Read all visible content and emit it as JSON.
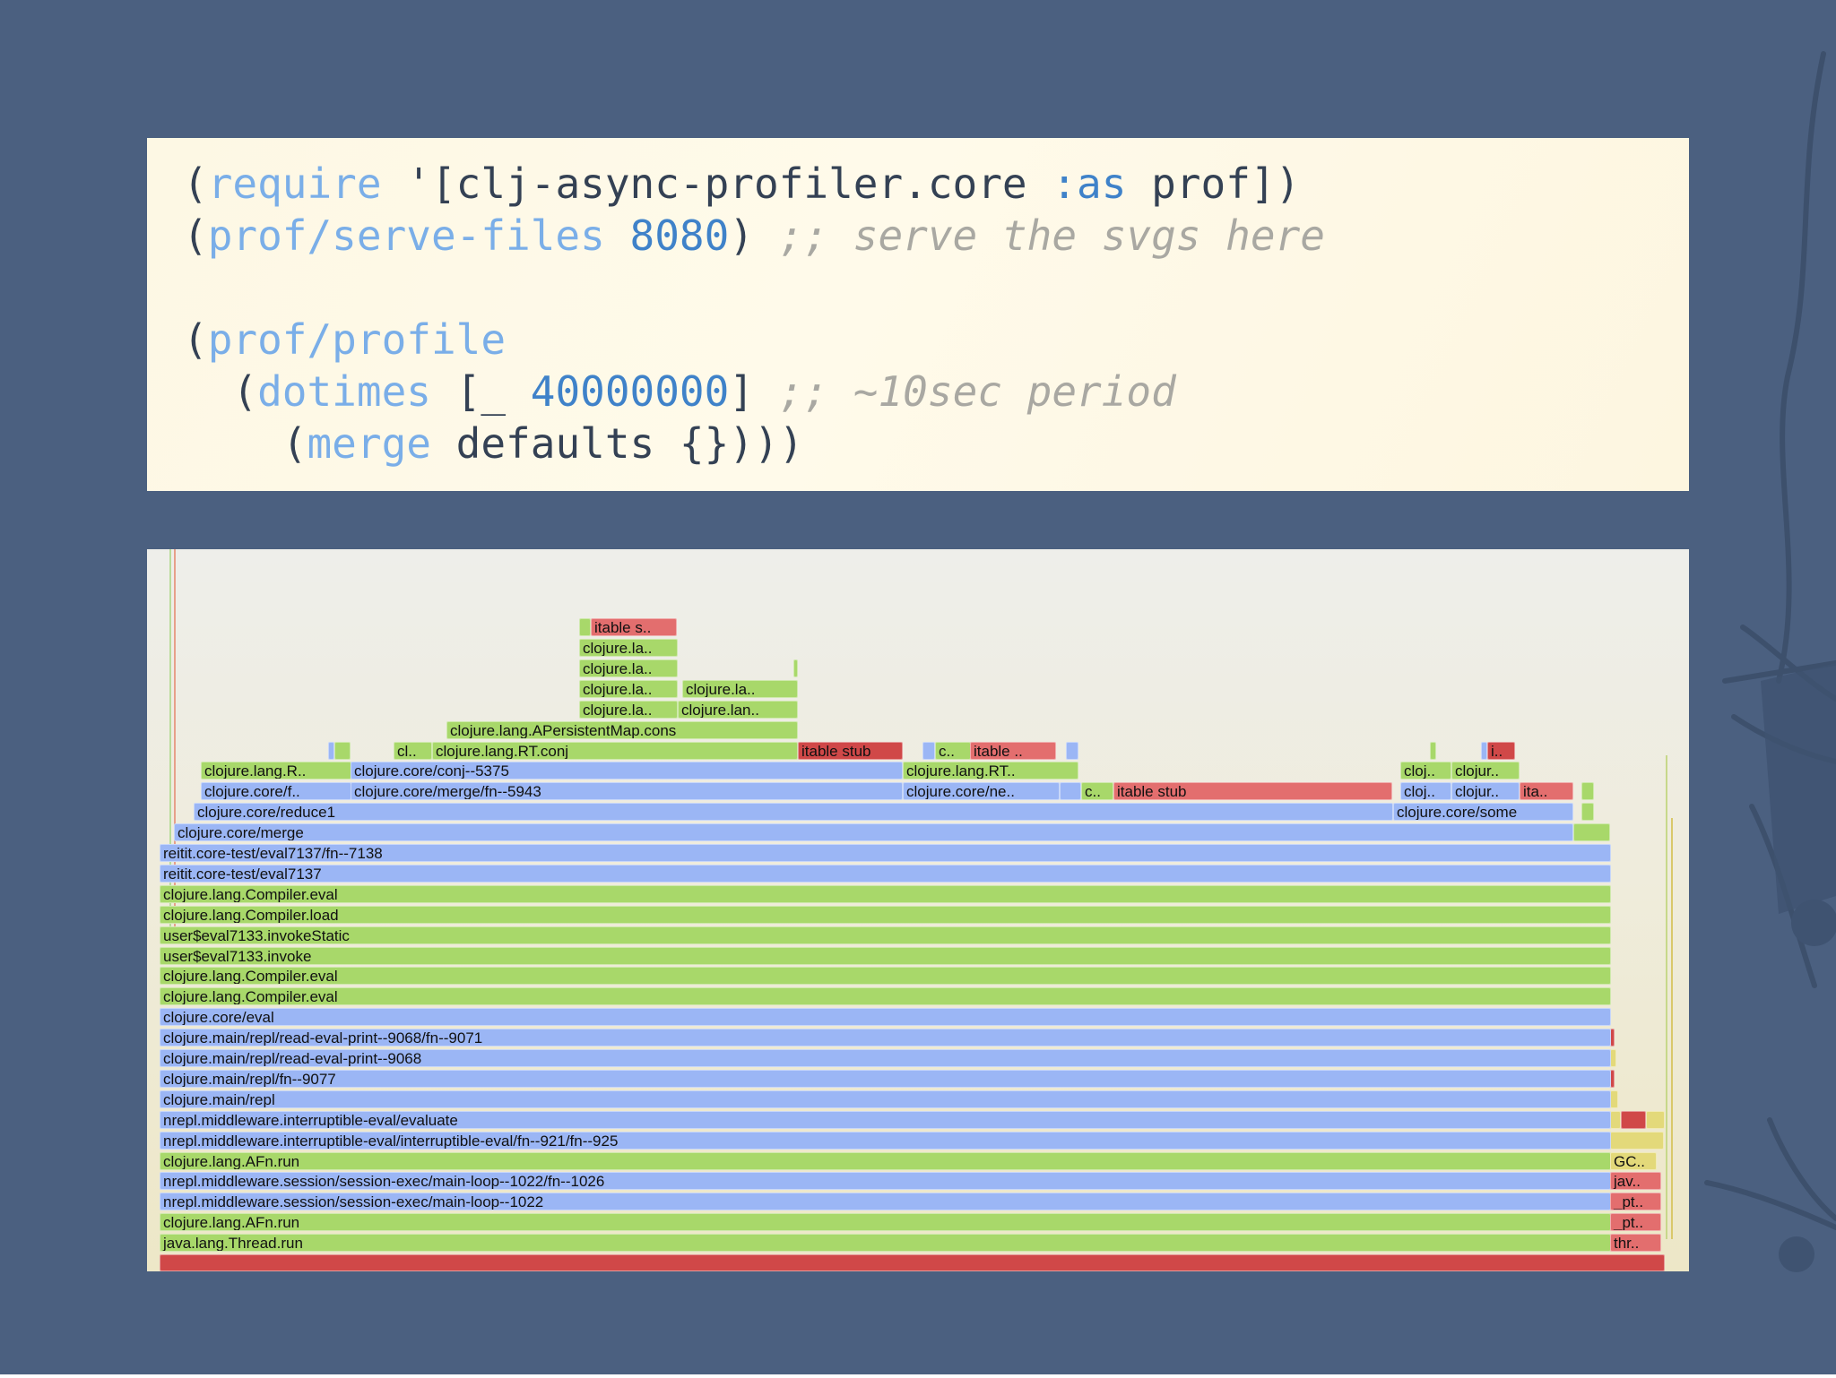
{
  "code": {
    "lines": [
      [
        {
          "t": "(",
          "c": "p"
        },
        {
          "t": "require",
          "c": "fn"
        },
        {
          "t": " '[clj-async-profiler.core ",
          "c": "p"
        },
        {
          "t": ":as",
          "c": "kw"
        },
        {
          "t": " prof])",
          "c": "p"
        }
      ],
      [
        {
          "t": "(",
          "c": "p"
        },
        {
          "t": "prof/serve-files",
          "c": "fn"
        },
        {
          "t": " ",
          "c": "p"
        },
        {
          "t": "8080",
          "c": "num"
        },
        {
          "t": ") ",
          "c": "p"
        },
        {
          "t": ";; serve the svgs here",
          "c": "cm"
        }
      ],
      [],
      [
        {
          "t": "(",
          "c": "p"
        },
        {
          "t": "prof/profile",
          "c": "fn"
        }
      ],
      [
        {
          "t": "  (",
          "c": "p"
        },
        {
          "t": "dotimes",
          "c": "fn"
        },
        {
          "t": " [_ ",
          "c": "p"
        },
        {
          "t": "40000000",
          "c": "num"
        },
        {
          "t": "] ",
          "c": "p"
        },
        {
          "t": ";; ~10sec period",
          "c": "cm"
        }
      ],
      [
        {
          "t": "    (",
          "c": "p"
        },
        {
          "t": "merge",
          "c": "fn"
        },
        {
          "t": " defaults {})))",
          "c": "p"
        }
      ]
    ]
  },
  "flamegraph": {
    "colors": {
      "green": "#a8d86a",
      "blue": "#9bb6f5",
      "red": "#e36e6e",
      "dark_red": "#d04848",
      "yellow": "#e3d97a"
    },
    "frames": [
      {
        "label": "itable s..",
        "color": "r",
        "level": 31,
        "x0": 0.2879,
        "x1": 0.344
      },
      {
        "label": "",
        "color": "g",
        "level": 31,
        "x0": 0.2803,
        "x1": 0.2879
      },
      {
        "label": "clojure.la..",
        "color": "g",
        "level": 30,
        "x0": 0.2803,
        "x1": 0.344
      },
      {
        "label": "clojure.la..",
        "color": "g",
        "level": 29,
        "x0": 0.2803,
        "x1": 0.344
      },
      {
        "label": "",
        "color": "g",
        "level": 29,
        "x0": 0.419,
        "x1": 0.422
      },
      {
        "label": "clojure.la..",
        "color": "g",
        "level": 28,
        "x0": 0.2803,
        "x1": 0.344
      },
      {
        "label": "clojure.la..",
        "color": "g",
        "level": 28,
        "x0": 0.347,
        "x1": 0.422
      },
      {
        "label": "clojure.la..",
        "color": "g",
        "level": 27,
        "x0": 0.2803,
        "x1": 0.344
      },
      {
        "label": "clojure.lan..",
        "color": "g",
        "level": 27,
        "x0": 0.344,
        "x1": 0.422
      },
      {
        "label": "clojure.lang.APersistentMap.cons",
        "color": "g",
        "level": 26,
        "x0": 0.194,
        "x1": 0.422
      },
      {
        "label": "",
        "color": "b",
        "level": 25,
        "x0": 0.1175,
        "x1": 0.1215
      },
      {
        "label": "",
        "color": "g",
        "level": 25,
        "x0": 0.1215,
        "x1": 0.132
      },
      {
        "label": "cl..",
        "color": "g",
        "level": 25,
        "x0": 0.16,
        "x1": 0.185
      },
      {
        "label": "clojure.lang.RT.conj",
        "color": "g",
        "level": 25,
        "x0": 0.185,
        "x1": 0.422
      },
      {
        "label": "itable stub",
        "color": "rd",
        "level": 25,
        "x0": 0.422,
        "x1": 0.49
      },
      {
        "label": "",
        "color": "b",
        "level": 25,
        "x0": 0.503,
        "x1": 0.511
      },
      {
        "label": "c..",
        "color": "g",
        "level": 25,
        "x0": 0.511,
        "x1": 0.534
      },
      {
        "label": "itable ..",
        "color": "r",
        "level": 25,
        "x0": 0.534,
        "x1": 0.59
      },
      {
        "label": "",
        "color": "b",
        "level": 25,
        "x0": 0.596,
        "x1": 0.604
      },
      {
        "label": "",
        "color": "g",
        "level": 25,
        "x0": 0.832,
        "x1": 0.836
      },
      {
        "label": "",
        "color": "b",
        "level": 25,
        "x0": 0.865,
        "x1": 0.869
      },
      {
        "label": "i..",
        "color": "rd",
        "level": 25,
        "x0": 0.869,
        "x1": 0.887
      },
      {
        "label": "clojure.lang.R..",
        "color": "g",
        "level": 24,
        "x0": 0.0346,
        "x1": 0.132
      },
      {
        "label": "clojure.core/conj--5375",
        "color": "b",
        "level": 24,
        "x0": 0.132,
        "x1": 0.49
      },
      {
        "label": "clojure.lang.RT..",
        "color": "g",
        "level": 24,
        "x0": 0.49,
        "x1": 0.604
      },
      {
        "label": "cloj..",
        "color": "g",
        "level": 24,
        "x0": 0.813,
        "x1": 0.846
      },
      {
        "label": "clojur..",
        "color": "g",
        "level": 24,
        "x0": 0.846,
        "x1": 0.89
      },
      {
        "label": "clojure.core/f..",
        "color": "b",
        "level": 23,
        "x0": 0.0346,
        "x1": 0.132
      },
      {
        "label": "clojure.core/merge/fn--5943",
        "color": "b",
        "level": 23,
        "x0": 0.132,
        "x1": 0.49
      },
      {
        "label": "clojure.core/ne..",
        "color": "b",
        "level": 23,
        "x0": 0.49,
        "x1": 0.592
      },
      {
        "label": "",
        "color": "b",
        "level": 23,
        "x0": 0.592,
        "x1": 0.606
      },
      {
        "label": "c..",
        "color": "g",
        "level": 23,
        "x0": 0.606,
        "x1": 0.627
      },
      {
        "label": "itable stub",
        "color": "r",
        "level": 23,
        "x0": 0.627,
        "x1": 0.808
      },
      {
        "label": "cloj..",
        "color": "b",
        "level": 23,
        "x0": 0.813,
        "x1": 0.846
      },
      {
        "label": "clojur..",
        "color": "b",
        "level": 23,
        "x0": 0.846,
        "x1": 0.89
      },
      {
        "label": "ita..",
        "color": "r",
        "level": 23,
        "x0": 0.89,
        "x1": 0.925
      },
      {
        "label": "",
        "color": "g",
        "level": 23,
        "x0": 0.93,
        "x1": 0.938
      },
      {
        "label": "clojure.core/reduce1",
        "color": "b",
        "level": 22,
        "x0": 0.03,
        "x1": 0.808
      },
      {
        "label": "clojure.core/some",
        "color": "b",
        "level": 22,
        "x0": 0.808,
        "x1": 0.925
      },
      {
        "label": "",
        "color": "g",
        "level": 22,
        "x0": 0.93,
        "x1": 0.938
      },
      {
        "label": "clojure.core/merge",
        "color": "b",
        "level": 21,
        "x0": 0.0173,
        "x1": 0.925
      },
      {
        "label": "",
        "color": "g",
        "level": 21,
        "x0": 0.925,
        "x1": 0.949
      },
      {
        "label": "reitit.core-test/eval7137/fn--7138",
        "color": "b",
        "level": 20,
        "x0": 0.008,
        "x1": 0.949
      },
      {
        "label": "reitit.core-test/eval7137",
        "color": "b",
        "level": 19,
        "x0": 0.008,
        "x1": 0.949
      },
      {
        "label": "clojure.lang.Compiler.eval",
        "color": "g",
        "level": 18,
        "x0": 0.008,
        "x1": 0.949
      },
      {
        "label": "clojure.lang.Compiler.load",
        "color": "g",
        "level": 17,
        "x0": 0.008,
        "x1": 0.949
      },
      {
        "label": "user$eval7133.invokeStatic",
        "color": "g",
        "level": 16,
        "x0": 0.008,
        "x1": 0.949
      },
      {
        "label": "user$eval7133.invoke",
        "color": "g",
        "level": 15,
        "x0": 0.008,
        "x1": 0.949
      },
      {
        "label": "clojure.lang.Compiler.eval",
        "color": "g",
        "level": 14,
        "x0": 0.008,
        "x1": 0.949
      },
      {
        "label": "clojure.lang.Compiler.eval",
        "color": "g",
        "level": 13,
        "x0": 0.008,
        "x1": 0.949
      },
      {
        "label": "clojure.core/eval",
        "color": "b",
        "level": 12,
        "x0": 0.008,
        "x1": 0.949
      },
      {
        "label": "",
        "color": "rd",
        "level": 11,
        "x0": 0.949,
        "x1": 0.952
      },
      {
        "label": "clojure.main/repl/read-eval-print--9068/fn--9071",
        "color": "b",
        "level": 11,
        "x0": 0.008,
        "x1": 0.949
      },
      {
        "label": "",
        "color": "y",
        "level": 10,
        "x0": 0.949,
        "x1": 0.953
      },
      {
        "label": "clojure.main/repl/read-eval-print--9068",
        "color": "b",
        "level": 10,
        "x0": 0.008,
        "x1": 0.949
      },
      {
        "label": "",
        "color": "rd",
        "level": 9,
        "x0": 0.949,
        "x1": 0.952
      },
      {
        "label": "clojure.main/repl/fn--9077",
        "color": "b",
        "level": 9,
        "x0": 0.008,
        "x1": 0.949
      },
      {
        "label": "",
        "color": "y",
        "level": 8,
        "x0": 0.949,
        "x1": 0.954
      },
      {
        "label": "clojure.main/repl",
        "color": "b",
        "level": 8,
        "x0": 0.008,
        "x1": 0.949
      },
      {
        "label": "",
        "color": "y",
        "level": 7,
        "x0": 0.949,
        "x1": 0.956
      },
      {
        "label": "",
        "color": "rd",
        "level": 7,
        "x0": 0.956,
        "x1": 0.972
      },
      {
        "label": "",
        "color": "y",
        "level": 7,
        "x0": 0.972,
        "x1": 0.984
      },
      {
        "label": "nrepl.middleware.interruptible-eval/evaluate",
        "color": "b",
        "level": 7,
        "x0": 0.008,
        "x1": 0.949
      },
      {
        "label": "",
        "color": "y",
        "level": 6,
        "x0": 0.949,
        "x1": 0.984
      },
      {
        "label": "nrepl.middleware.interruptible-eval/interruptible-eval/fn--921/fn--925",
        "color": "b",
        "level": 6,
        "x0": 0.008,
        "x1": 0.949
      },
      {
        "label": "clojure.lang.AFn.run",
        "color": "g",
        "level": 5,
        "x0": 0.008,
        "x1": 0.949
      },
      {
        "label": "GC..",
        "color": "y",
        "level": 5,
        "x0": 0.949,
        "x1": 0.979
      },
      {
        "label": "nrepl.middleware.session/session-exec/main-loop--1022/fn--1026",
        "color": "b",
        "level": 4,
        "x0": 0.008,
        "x1": 0.949
      },
      {
        "label": "jav..",
        "color": "r",
        "level": 4,
        "x0": 0.949,
        "x1": 0.982
      },
      {
        "label": "nrepl.middleware.session/session-exec/main-loop--1022",
        "color": "b",
        "level": 3,
        "x0": 0.008,
        "x1": 0.949
      },
      {
        "label": "_pt..",
        "color": "r",
        "level": 3,
        "x0": 0.949,
        "x1": 0.982
      },
      {
        "label": "clojure.lang.AFn.run",
        "color": "g",
        "level": 2,
        "x0": 0.008,
        "x1": 0.949
      },
      {
        "label": "_pt..",
        "color": "r",
        "level": 2,
        "x0": 0.949,
        "x1": 0.982
      },
      {
        "label": "java.lang.Thread.run",
        "color": "g",
        "level": 1,
        "x0": 0.008,
        "x1": 0.949
      },
      {
        "label": "thr..",
        "color": "r",
        "level": 1,
        "x0": 0.949,
        "x1": 0.982
      },
      {
        "label": "",
        "color": "rd",
        "level": 0,
        "x0": 0.008,
        "x1": 0.984
      }
    ]
  }
}
